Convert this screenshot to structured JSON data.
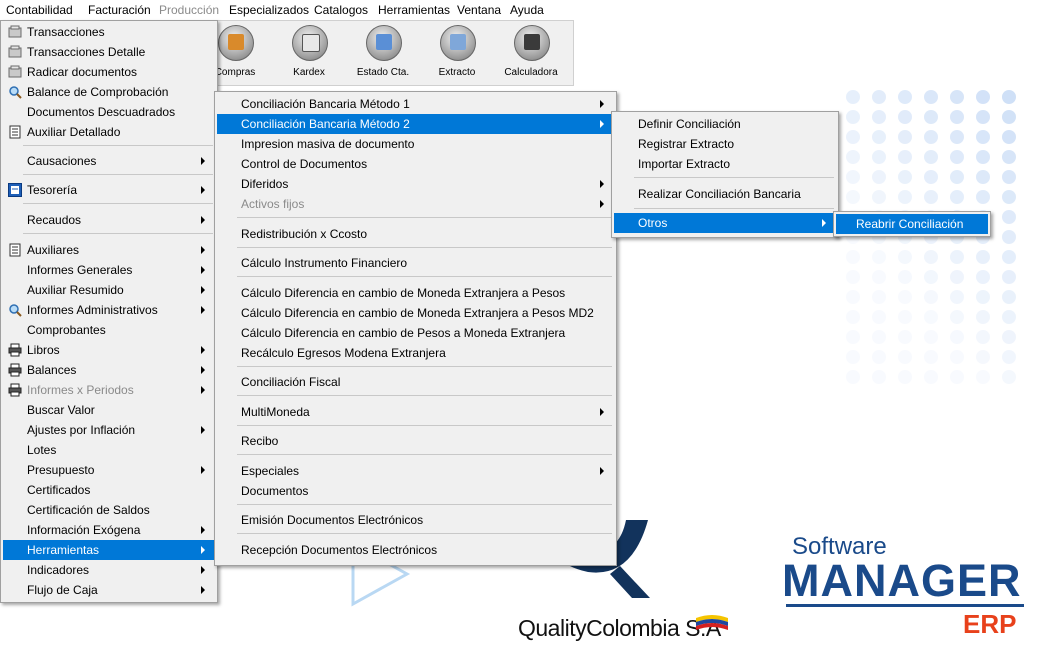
{
  "menubar": {
    "items": [
      {
        "label": "Contabilidad",
        "disabled": false
      },
      {
        "label": "Facturación",
        "disabled": false
      },
      {
        "label": "Producción",
        "disabled": true
      },
      {
        "label": "Especializados",
        "disabled": false
      },
      {
        "label": "Catalogos",
        "disabled": false
      },
      {
        "label": "Herramientas",
        "disabled": false
      },
      {
        "label": "Ventana",
        "disabled": false
      },
      {
        "label": "Ayuda",
        "disabled": false
      }
    ]
  },
  "toolbar": {
    "items": [
      {
        "label": "Compras",
        "icon": "truck-icon"
      },
      {
        "label": "Kardex",
        "icon": "document-add-icon"
      },
      {
        "label": "Estado Cta.",
        "icon": "statement-icon"
      },
      {
        "label": "Extracto",
        "icon": "extract-icon"
      },
      {
        "label": "Calculadora",
        "icon": "calculator-icon"
      }
    ]
  },
  "contabilidad_menu": {
    "items": [
      {
        "label": "Transacciones",
        "icon": "transactions-icon"
      },
      {
        "label": "Transacciones Detalle",
        "icon": "transactions-icon"
      },
      {
        "label": "Radicar documentos",
        "icon": "transactions-icon"
      },
      {
        "label": "Balance de Comprobación",
        "icon": "magnifier-icon"
      },
      {
        "label": "Documentos Descuadrados"
      },
      {
        "label": "Auxiliar Detallado",
        "icon": "ledger-icon"
      },
      {
        "label": "Causaciones",
        "submenu": true
      },
      {
        "label": "Tesorería",
        "icon": "treasury-icon",
        "submenu": true
      },
      {
        "label": "Recaudos",
        "submenu": true
      },
      {
        "label": "Auxiliares",
        "icon": "ledger-icon",
        "submenu": true
      },
      {
        "label": "Informes Generales",
        "submenu": true
      },
      {
        "label": "Auxiliar Resumido",
        "submenu": true
      },
      {
        "label": "Informes Administrativos",
        "icon": "magnifier-icon",
        "submenu": true
      },
      {
        "label": "Comprobantes"
      },
      {
        "label": "Libros",
        "icon": "printer-icon",
        "submenu": true
      },
      {
        "label": "Balances",
        "icon": "printer-icon",
        "submenu": true
      },
      {
        "label": "Informes x Periodos",
        "icon": "printer-icon",
        "submenu": true,
        "disabled": true
      },
      {
        "label": "Buscar Valor"
      },
      {
        "label": "Ajustes por Inflación",
        "submenu": true
      },
      {
        "label": "Lotes"
      },
      {
        "label": "Presupuesto",
        "submenu": true
      },
      {
        "label": "Certificados"
      },
      {
        "label": "Certificación de Saldos"
      },
      {
        "label": "Información Exógena",
        "submenu": true
      },
      {
        "label": "Herramientas",
        "submenu": true,
        "highlighted": true
      },
      {
        "label": "Indicadores",
        "submenu": true
      },
      {
        "label": "Flujo de Caja",
        "submenu": true
      }
    ]
  },
  "herramientas_menu": {
    "items": [
      {
        "label": "Conciliación Bancaria  Método 1",
        "submenu": true
      },
      {
        "label": "Conciliación Bancaria Método 2",
        "submenu": true,
        "highlighted": true
      },
      {
        "label": "Impresion masiva de documento"
      },
      {
        "label": "Control de Documentos"
      },
      {
        "label": "Diferidos",
        "submenu": true
      },
      {
        "label": "Activos fijos",
        "submenu": true,
        "disabled": true
      },
      {
        "label": "Redistribución x Ccosto"
      },
      {
        "label": "Cálculo Instrumento Financiero"
      },
      {
        "label": "Cálculo Diferencia en cambio de Moneda Extranjera a Pesos"
      },
      {
        "label": "Cálculo Diferencia en cambio de Moneda Extranjera a Pesos MD2"
      },
      {
        "label": "Cálculo Diferencia en cambio de Pesos a Moneda Extranjera"
      },
      {
        "label": "Recálculo Egresos Modena Extranjera"
      },
      {
        "label": "Conciliación Fiscal"
      },
      {
        "label": "MultiMoneda",
        "submenu": true
      },
      {
        "label": "Recibo"
      },
      {
        "label": "Especiales",
        "submenu": true
      },
      {
        "label": "Documentos"
      },
      {
        "label": "Emisión Documentos Electrónicos"
      },
      {
        "label": "Recepción Documentos Electrónicos"
      }
    ]
  },
  "metodo2_menu": {
    "items": [
      {
        "label": "Definir Conciliación"
      },
      {
        "label": "Registrar Extracto"
      },
      {
        "label": "Importar Extracto"
      },
      {
        "label": "Realizar Conciliación Bancaria"
      },
      {
        "label": "Otros",
        "submenu": true,
        "highlighted": true
      }
    ]
  },
  "otros_menu": {
    "items": [
      {
        "label": "Reabrir Conciliación",
        "highlighted": true
      }
    ]
  },
  "branding": {
    "quality_name": "QualityColombia S.A",
    "software_word": "Software",
    "manager_word": "MANAGER",
    "erp_word": "ERP"
  },
  "colors": {
    "highlight": "#0078d7",
    "menu_bg": "#f0f0f0",
    "brand_blue": "#1a4a8a",
    "brand_orange": "#e8411b",
    "dot_blue": "#cfe0f7"
  }
}
